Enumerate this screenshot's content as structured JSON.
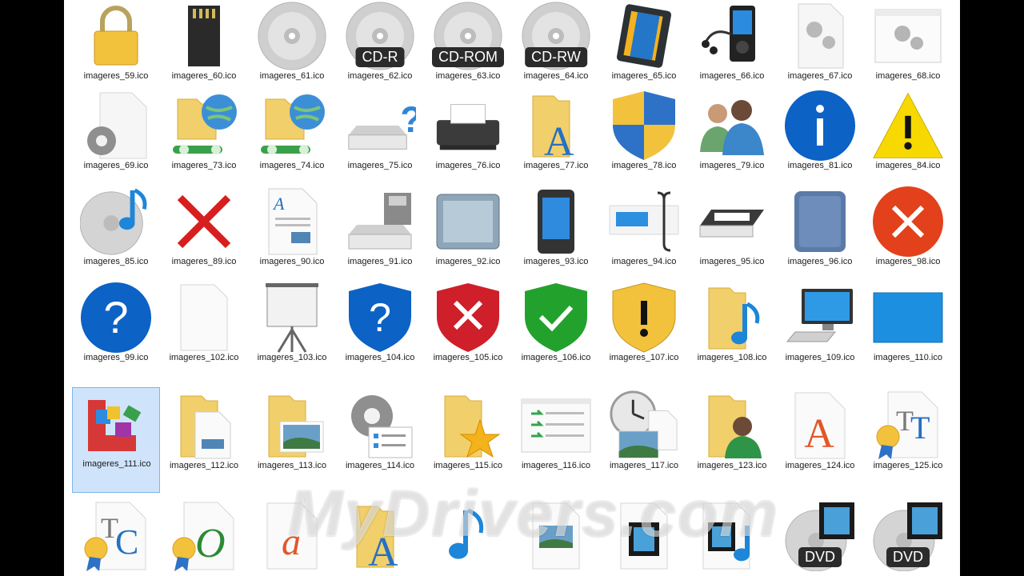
{
  "watermark": "MyDrivers.com",
  "rows": [
    [
      {
        "label": "imageres_59.ico",
        "icon": "padlock-icon"
      },
      {
        "label": "imageres_60.ico",
        "icon": "sd-card-icon"
      },
      {
        "label": "imageres_61.ico",
        "icon": "disc-icon"
      },
      {
        "label": "imageres_62.ico",
        "icon": "disc-icon",
        "badge": "CD-R"
      },
      {
        "label": "imageres_63.ico",
        "icon": "disc-icon",
        "badge": "CD-ROM"
      },
      {
        "label": "imageres_64.ico",
        "icon": "disc-icon",
        "badge": "CD-RW"
      },
      {
        "label": "imageres_65.ico",
        "icon": "media-card-icon"
      },
      {
        "label": "imageres_66.ico",
        "icon": "media-player-icon"
      },
      {
        "label": "imageres_67.ico",
        "icon": "settings-file-icon"
      },
      {
        "label": "imageres_68.ico",
        "icon": "settings-window-icon"
      }
    ],
    [
      {
        "label": "imageres_69.ico",
        "icon": "gear-file-icon"
      },
      {
        "label": "imageres_73.ico",
        "icon": "network-folder-icon"
      },
      {
        "label": "imageres_74.ico",
        "icon": "network-folder-icon"
      },
      {
        "label": "imageres_75.ico",
        "icon": "unknown-drive-icon"
      },
      {
        "label": "imageres_76.ico",
        "icon": "fax-printer-icon"
      },
      {
        "label": "imageres_77.ico",
        "icon": "fonts-folder-icon"
      },
      {
        "label": "imageres_78.ico",
        "icon": "security-shield-icon"
      },
      {
        "label": "imageres_79.ico",
        "icon": "users-icon"
      },
      {
        "label": "imageres_81.ico",
        "icon": "info-icon"
      },
      {
        "label": "imageres_84.ico",
        "icon": "warning-icon"
      }
    ],
    [
      {
        "label": "imageres_85.ico",
        "icon": "music-disc-icon"
      },
      {
        "label": "imageres_89.ico",
        "icon": "red-x-icon"
      },
      {
        "label": "imageres_90.ico",
        "icon": "document-icon"
      },
      {
        "label": "imageres_91.ico",
        "icon": "floppy-drive-icon"
      },
      {
        "label": "imageres_92.ico",
        "icon": "device-panel-icon"
      },
      {
        "label": "imageres_93.ico",
        "icon": "tablet-icon"
      },
      {
        "label": "imageres_94.ico",
        "icon": "rename-field-icon"
      },
      {
        "label": "imageres_95.ico",
        "icon": "scanner-icon"
      },
      {
        "label": "imageres_96.ico",
        "icon": "blue-device-icon"
      },
      {
        "label": "imageres_98.ico",
        "icon": "error-icon"
      }
    ],
    [
      {
        "label": "imageres_99.ico",
        "icon": "help-icon"
      },
      {
        "label": "imageres_102.ico",
        "icon": "blank-page-icon"
      },
      {
        "label": "imageres_103.ico",
        "icon": "projector-screen-icon"
      },
      {
        "label": "imageres_104.ico",
        "icon": "help-shield-icon"
      },
      {
        "label": "imageres_105.ico",
        "icon": "error-shield-icon"
      },
      {
        "label": "imageres_106.ico",
        "icon": "ok-shield-icon"
      },
      {
        "label": "imageres_107.ico",
        "icon": "warning-shield-icon"
      },
      {
        "label": "imageres_108.ico",
        "icon": "music-folder-icon"
      },
      {
        "label": "imageres_109.ico",
        "icon": "computer-icon"
      },
      {
        "label": "imageres_110.ico",
        "icon": "desktop-icon"
      }
    ],
    [
      {
        "label": "imageres_111.ico",
        "icon": "defrag-icon",
        "selected": true
      },
      {
        "label": "imageres_112.ico",
        "icon": "documents-folder-icon"
      },
      {
        "label": "imageres_113.ico",
        "icon": "pictures-folder-icon"
      },
      {
        "label": "imageres_114.ico",
        "icon": "gear-checklist-icon"
      },
      {
        "label": "imageres_115.ico",
        "icon": "favorites-folder-icon"
      },
      {
        "label": "imageres_116.ico",
        "icon": "list-window-icon"
      },
      {
        "label": "imageres_117.ico",
        "icon": "clock-picture-icon"
      },
      {
        "label": "imageres_123.ico",
        "icon": "user-folder-icon"
      },
      {
        "label": "imageres_124.ico",
        "icon": "font-a-icon"
      },
      {
        "label": "imageres_125.ico",
        "icon": "font-tt-icon"
      }
    ],
    [
      {
        "label": "",
        "icon": "font-tc-icon"
      },
      {
        "label": "",
        "icon": "font-o-icon"
      },
      {
        "label": "",
        "icon": "font-a-italic-icon"
      },
      {
        "label": "",
        "icon": "fonts-folder-icon"
      },
      {
        "label": "",
        "icon": "music-note-icon"
      },
      {
        "label": "",
        "icon": "picture-file-icon"
      },
      {
        "label": "",
        "icon": "video-file-icon"
      },
      {
        "label": "",
        "icon": "video-music-icon"
      },
      {
        "label": "",
        "icon": "dvd-icon",
        "badge": "DVD"
      },
      {
        "label": "",
        "icon": "dvd-icon",
        "badge": "DVD"
      }
    ]
  ]
}
